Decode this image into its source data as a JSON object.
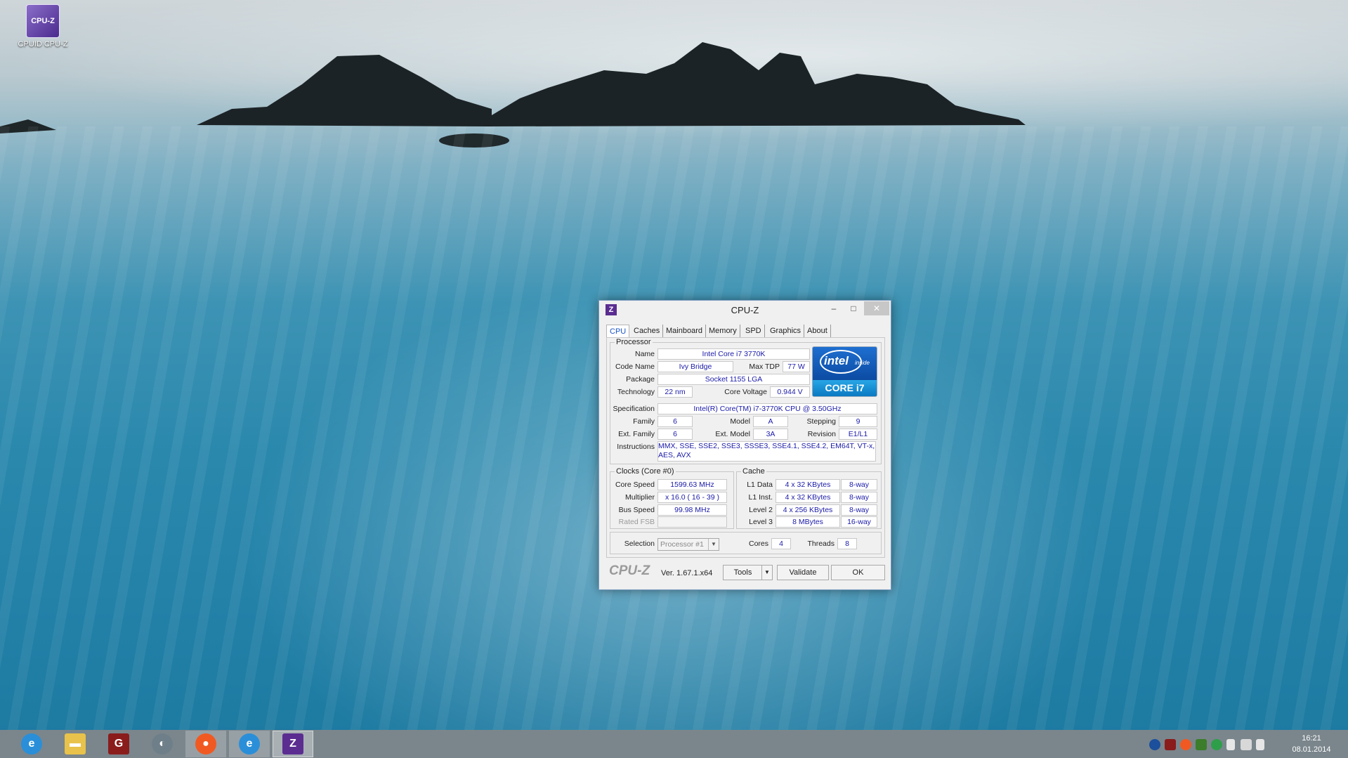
{
  "desktop": {
    "icon_label": "CPUID CPU-Z",
    "icon_glyph": "CPU-Z"
  },
  "window": {
    "title": "CPU-Z",
    "app_icon": "Z",
    "controls": {
      "minimize": "–",
      "maximize": "□",
      "close": "✕"
    }
  },
  "tabs": [
    {
      "label": "CPU",
      "active": true
    },
    {
      "label": "Caches"
    },
    {
      "label": "Mainboard"
    },
    {
      "label": "Memory"
    },
    {
      "label": "SPD"
    },
    {
      "label": "Graphics"
    },
    {
      "label": "About"
    }
  ],
  "processor": {
    "legend": "Processor",
    "name_label": "Name",
    "name": "Intel Core i7 3770K",
    "codename_label": "Code Name",
    "codename": "Ivy Bridge",
    "maxtdp_label": "Max TDP",
    "maxtdp": "77 W",
    "package_label": "Package",
    "package": "Socket 1155 LGA",
    "technology_label": "Technology",
    "technology": "22 nm",
    "corevoltage_label": "Core Voltage",
    "corevoltage": "0.944 V",
    "spec_label": "Specification",
    "spec": "Intel(R) Core(TM) i7-3770K CPU @ 3.50GHz",
    "family_label": "Family",
    "family": "6",
    "model_label": "Model",
    "model": "A",
    "stepping_label": "Stepping",
    "stepping": "9",
    "extfamily_label": "Ext. Family",
    "extfamily": "6",
    "extmodel_label": "Ext. Model",
    "extmodel": "3A",
    "revision_label": "Revision",
    "revision": "E1/L1",
    "instructions_label": "Instructions",
    "instructions": "MMX, SSE, SSE2, SSE3, SSSE3, SSE4.1, SSE4.2, EM64T, VT-x, AES, AVX",
    "logo_brand": "intel",
    "logo_inside": "inside",
    "logo_core": "CORE i7"
  },
  "clocks": {
    "legend": "Clocks (Core #0)",
    "corespeed_label": "Core Speed",
    "corespeed": "1599.63 MHz",
    "multiplier_label": "Multiplier",
    "multiplier": "x 16.0 ( 16 - 39 )",
    "busspeed_label": "Bus Speed",
    "busspeed": "99.98 MHz",
    "ratedfsb_label": "Rated FSB",
    "ratedfsb": ""
  },
  "cache": {
    "legend": "Cache",
    "rows": [
      {
        "label": "L1 Data",
        "size": "4 x 32 KBytes",
        "way": "8-way"
      },
      {
        "label": "L1 Inst.",
        "size": "4 x 32 KBytes",
        "way": "8-way"
      },
      {
        "label": "Level 2",
        "size": "4 x 256 KBytes",
        "way": "8-way"
      },
      {
        "label": "Level 3",
        "size": "8 MBytes",
        "way": "16-way"
      }
    ]
  },
  "selection": {
    "label": "Selection",
    "value": "Processor #1",
    "cores_label": "Cores",
    "cores": "4",
    "threads_label": "Threads",
    "threads": "8"
  },
  "footer": {
    "logo": "CPU-Z",
    "version": "Ver. 1.67.1.x64",
    "tools": "Tools",
    "validate": "Validate",
    "ok": "OK"
  },
  "taskbar": {
    "items": [
      {
        "name": "Internet Explorer",
        "glyph": "e",
        "color": "#2a8fd8"
      },
      {
        "name": "File Explorer",
        "glyph": "▬",
        "color": "#e8c24a"
      },
      {
        "name": "GPU Tweak",
        "glyph": "G",
        "color": "#8a1c1c"
      },
      {
        "name": "Media Player",
        "glyph": "◐",
        "color": "#6f7f8a"
      },
      {
        "name": "Origin",
        "glyph": "●",
        "color": "#f05a22"
      },
      {
        "name": "Internet Explorer",
        "glyph": "e",
        "color": "#2a8fd8"
      },
      {
        "name": "CPU-Z",
        "glyph": "Z",
        "color": "#5b2d91"
      }
    ],
    "clock_time": "16:21",
    "clock_date": "08.01.2014"
  }
}
